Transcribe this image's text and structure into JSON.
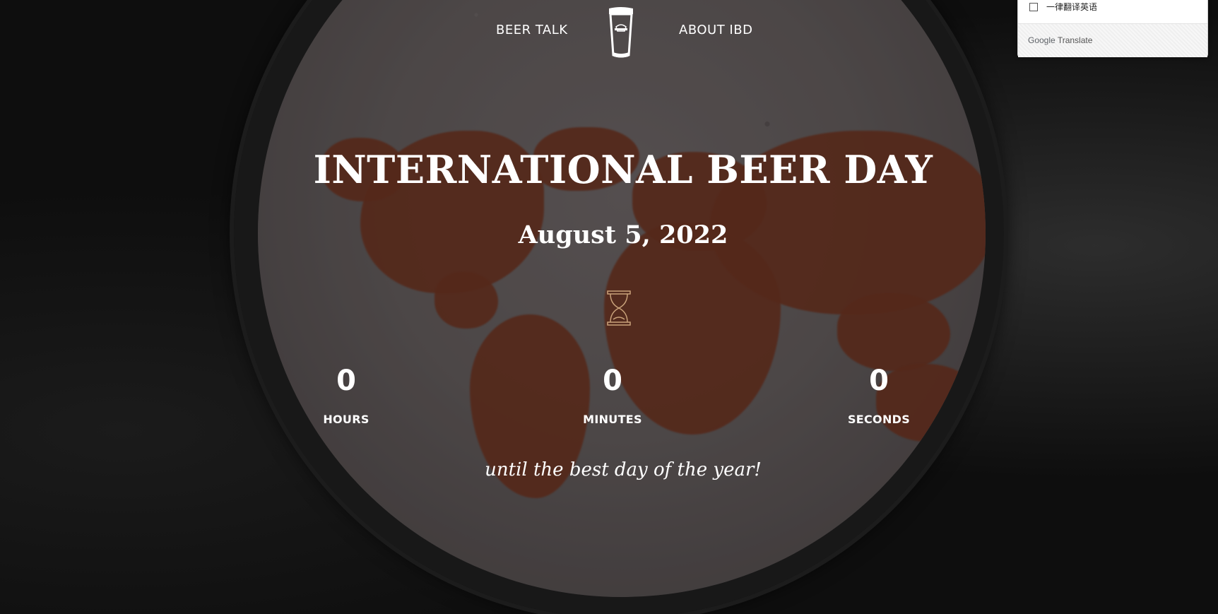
{
  "nav": {
    "left_label": "BEER TALK",
    "right_label": "ABOUT IBD",
    "logo_icon": "beer-glass-icon"
  },
  "hero": {
    "title": "INTERNATIONAL BEER DAY",
    "date": "August 5, 2022",
    "timer_icon": "hourglass-icon"
  },
  "countdown": {
    "hours_value": "0",
    "hours_label": "HOURS",
    "minutes_value": "0",
    "minutes_label": "MINUTES",
    "seconds_value": "0",
    "seconds_label": "SECONDS"
  },
  "tagline": "until the best day of the year!",
  "translate_popup": {
    "option_label": "一律翻译英语",
    "brand_google": "Google",
    "brand_translate": "Translate"
  },
  "colors": {
    "background": "#0e0e0e",
    "foam": "#5f5858",
    "map": "#6b2f1c",
    "text": "#ffffff"
  }
}
